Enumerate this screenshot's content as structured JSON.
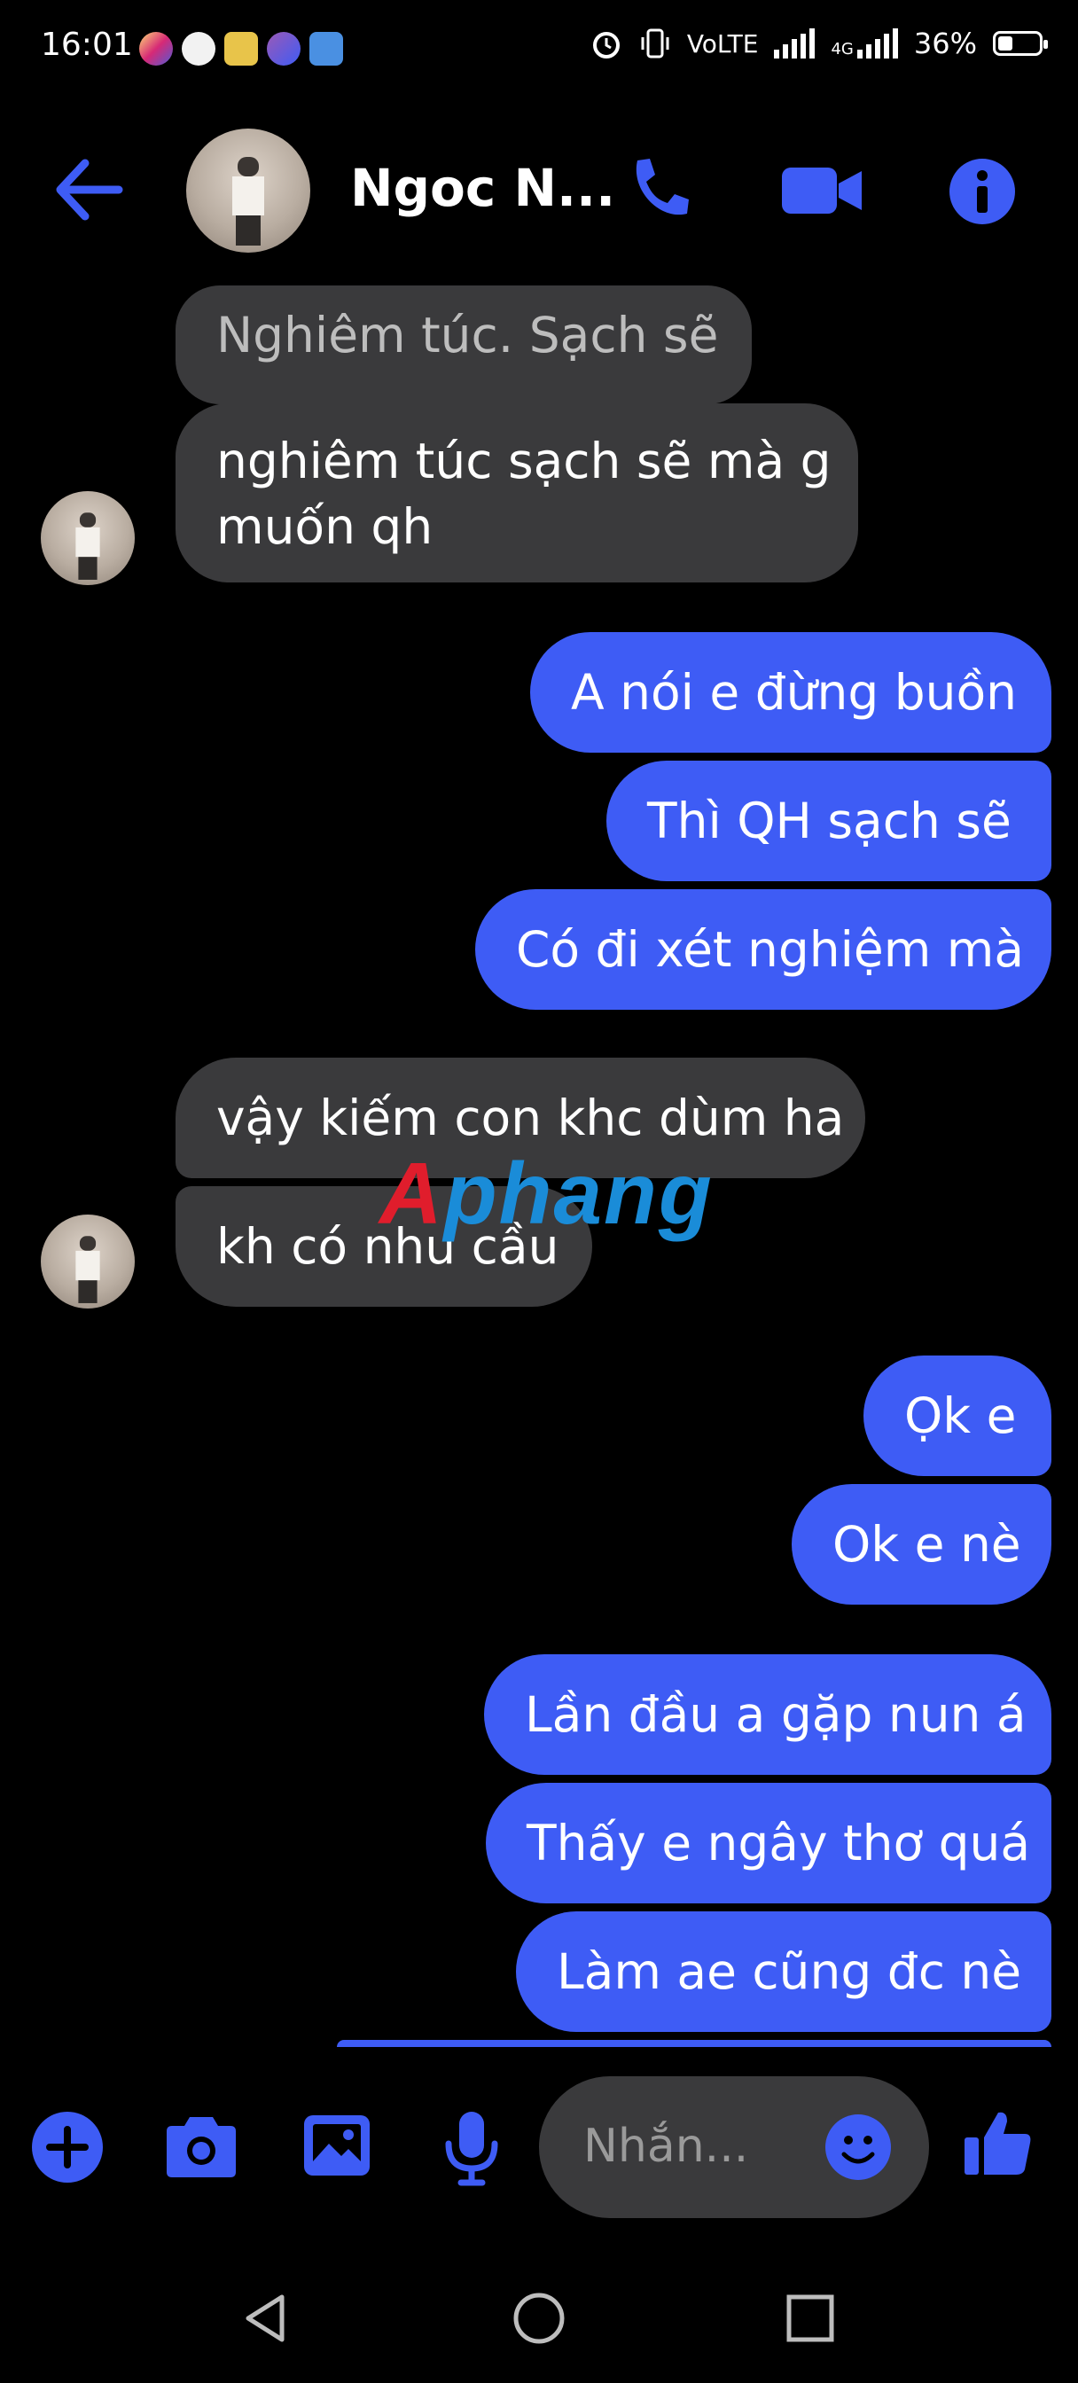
{
  "status_bar": {
    "time": "16:01",
    "network": "VoLTE",
    "network_type": "4G",
    "battery": "36%",
    "battery_level": 0.36
  },
  "header": {
    "contact_name": "Ngoc N...",
    "icons": [
      "back-arrow-icon",
      "phone-icon",
      "video-camera-icon",
      "info-icon"
    ]
  },
  "messages": [
    {
      "from": "them",
      "text": "Nghiêm túc. Sạch sẽ",
      "type": "reply-quote"
    },
    {
      "from": "them",
      "lines": [
        "nghiêm túc sạch sẽ mà g",
        "muốn qh"
      ]
    },
    {
      "from": "me",
      "text": "A nói e đừng buồn"
    },
    {
      "from": "me",
      "text": "Thì QH sạch sẽ"
    },
    {
      "from": "me",
      "text": "Có đi xét nghiệm mà"
    },
    {
      "from": "them",
      "text": "vậy kiếm con khc dùm ha"
    },
    {
      "from": "them",
      "text": "kh có nhu cầu"
    },
    {
      "from": "me",
      "text": "Ọk e"
    },
    {
      "from": "me",
      "text": "Ok e nè"
    },
    {
      "from": "me",
      "text": "Lần đầu a gặp nun á"
    },
    {
      "from": "me",
      "text": "Thấy e ngây thơ quá"
    },
    {
      "from": "me",
      "text": "Làm ae cũng đc nè"
    }
  ],
  "watermark": {
    "part1": "A",
    "part2": "phang"
  },
  "composer": {
    "placeholder": "Nhắn...",
    "icons": [
      "plus-icon",
      "camera-icon",
      "image-icon",
      "microphone-icon",
      "emoji-icon",
      "thumbs-up-icon"
    ]
  },
  "colors": {
    "background": "#000000",
    "outgoing_bubble": "#3e5cf5",
    "incoming_bubble": "#3a3a3c",
    "accent": "#3e5cf5"
  }
}
